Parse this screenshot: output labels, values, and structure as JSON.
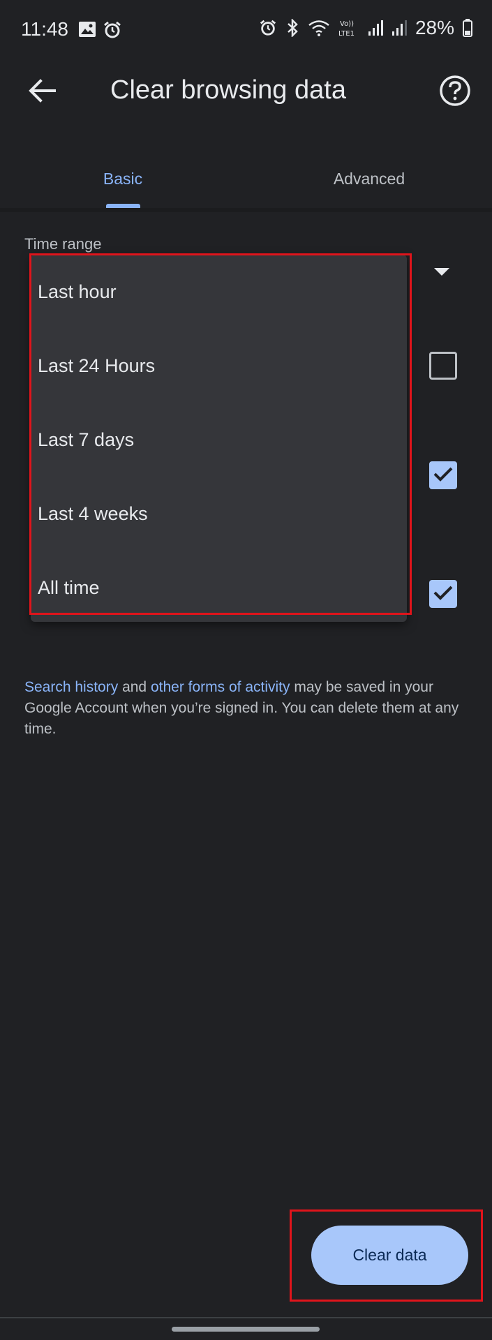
{
  "status_bar": {
    "time": "11:48",
    "battery": "28%",
    "icons": [
      "image-icon",
      "alarm-icon",
      "alarm-icon",
      "bluetooth-icon",
      "wifi-icon",
      "volte-icon",
      "signal-icon",
      "signal-icon",
      "battery-icon"
    ]
  },
  "app_bar": {
    "title": "Clear browsing data",
    "back_icon": "arrow-back-icon",
    "help_icon": "help-icon"
  },
  "tabs": [
    {
      "label": "Basic",
      "selected": true
    },
    {
      "label": "Advanced",
      "selected": false
    }
  ],
  "time_range": {
    "label": "Time range"
  },
  "dropdown": {
    "options": [
      "Last hour",
      "Last 24 Hours",
      "Last 7 days",
      "Last 4 weeks",
      "All time"
    ]
  },
  "checkboxes": [
    {
      "checked": false
    },
    {
      "checked": true
    },
    {
      "checked": true
    }
  ],
  "footnote": {
    "link1": "Search history",
    "text1": " and ",
    "link2": "other forms of activity",
    "text2": " may be saved in your Google Account when you’re signed in. You can delete them at any time."
  },
  "clear_button": {
    "label": "Clear data"
  },
  "colors": {
    "background": "#202124",
    "accent": "#8ab4f8",
    "button": "#a8c7fa",
    "menu": "#35363a",
    "highlight": "#e0141b"
  }
}
